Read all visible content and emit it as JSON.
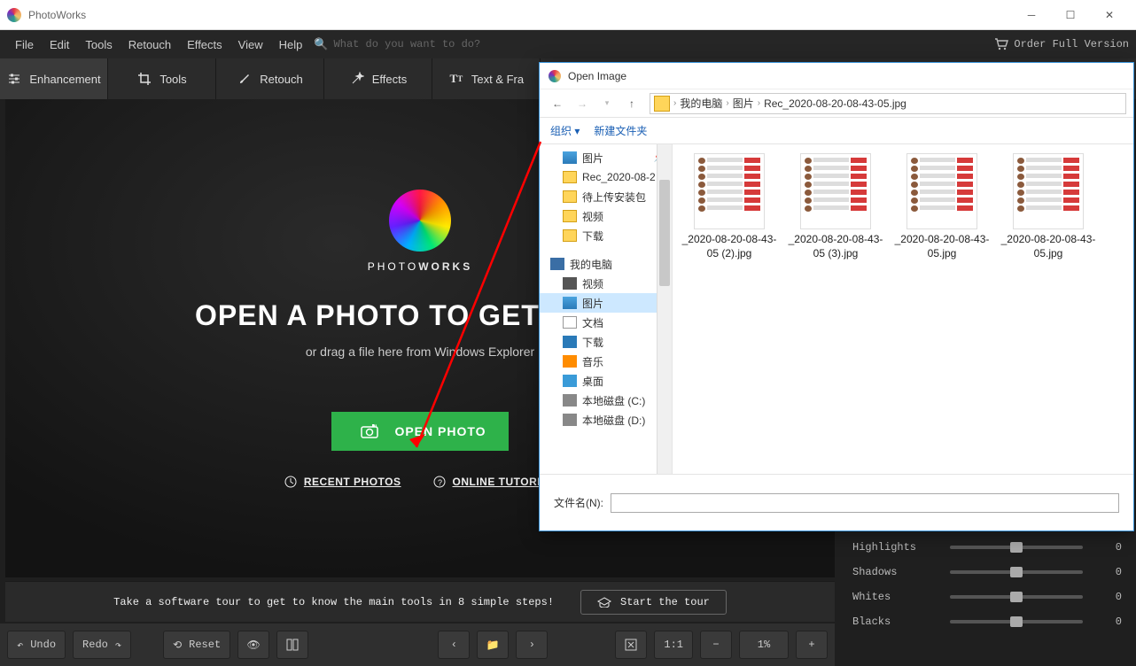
{
  "window": {
    "title": "PhotoWorks"
  },
  "menu": {
    "items": [
      "File",
      "Edit",
      "Tools",
      "Retouch",
      "Effects",
      "View",
      "Help"
    ],
    "search_placeholder": "What do you want to do?",
    "order": "Order Full Version"
  },
  "tabs": {
    "enhancement": "Enhancement",
    "tools": "Tools",
    "retouch": "Retouch",
    "effects": "Effects",
    "text": "Text & Fra"
  },
  "welcome": {
    "brand1": "PHOTO",
    "brand2": "WORKS",
    "heading": "OPEN A PHOTO TO GET START",
    "sub": "or drag a file here from Windows Explorer",
    "open_btn": "OPEN PHOTO",
    "recent": "RECENT PHOTOS",
    "tutorials": "ONLINE TUTORIAL"
  },
  "tour": {
    "text": "Take a software tour to get to know the main tools in 8 simple steps!",
    "btn": "Start the tour"
  },
  "sliders": {
    "highlights": {
      "label": "Highlights",
      "value": "0"
    },
    "shadows": {
      "label": "Shadows",
      "value": "0"
    },
    "whites": {
      "label": "Whites",
      "value": "0"
    },
    "blacks": {
      "label": "Blacks",
      "value": "0"
    }
  },
  "bottom": {
    "undo": "Undo",
    "redo": "Redo",
    "reset": "Reset",
    "fit": "1:1",
    "zoom": "1%"
  },
  "dialog": {
    "title": "Open Image",
    "crumbs": [
      "我的电脑",
      "图片",
      "Rec_2020-08-20-08-43-05.jpg"
    ],
    "organize": "组织 ▾",
    "newfolder": "新建文件夹",
    "tree": [
      {
        "label": "图片",
        "type": "pic",
        "pinned": true
      },
      {
        "label": "Rec_2020-08-2",
        "type": "folder"
      },
      {
        "label": "待上传安装包",
        "type": "folder"
      },
      {
        "label": "视频",
        "type": "folder"
      },
      {
        "label": "下载",
        "type": "folder"
      },
      {
        "label": "我的电脑",
        "type": "pc",
        "group": true
      },
      {
        "label": "视频",
        "type": "video"
      },
      {
        "label": "图片",
        "type": "pic",
        "selected": true
      },
      {
        "label": "文档",
        "type": "doc"
      },
      {
        "label": "下载",
        "type": "down"
      },
      {
        "label": "音乐",
        "type": "music"
      },
      {
        "label": "桌面",
        "type": "desk"
      },
      {
        "label": "本地磁盘 (C:)",
        "type": "disk"
      },
      {
        "label": "本地磁盘 (D:)",
        "type": "disk"
      }
    ],
    "files": [
      "_2020-08-20-08-43-05 (2).jpg",
      "_2020-08-20-08-43-05 (3).jpg",
      "_2020-08-20-08-43-05.jpg",
      "_2020-08-20-08-43-05.jpg"
    ],
    "filename_label": "文件名(N):"
  }
}
